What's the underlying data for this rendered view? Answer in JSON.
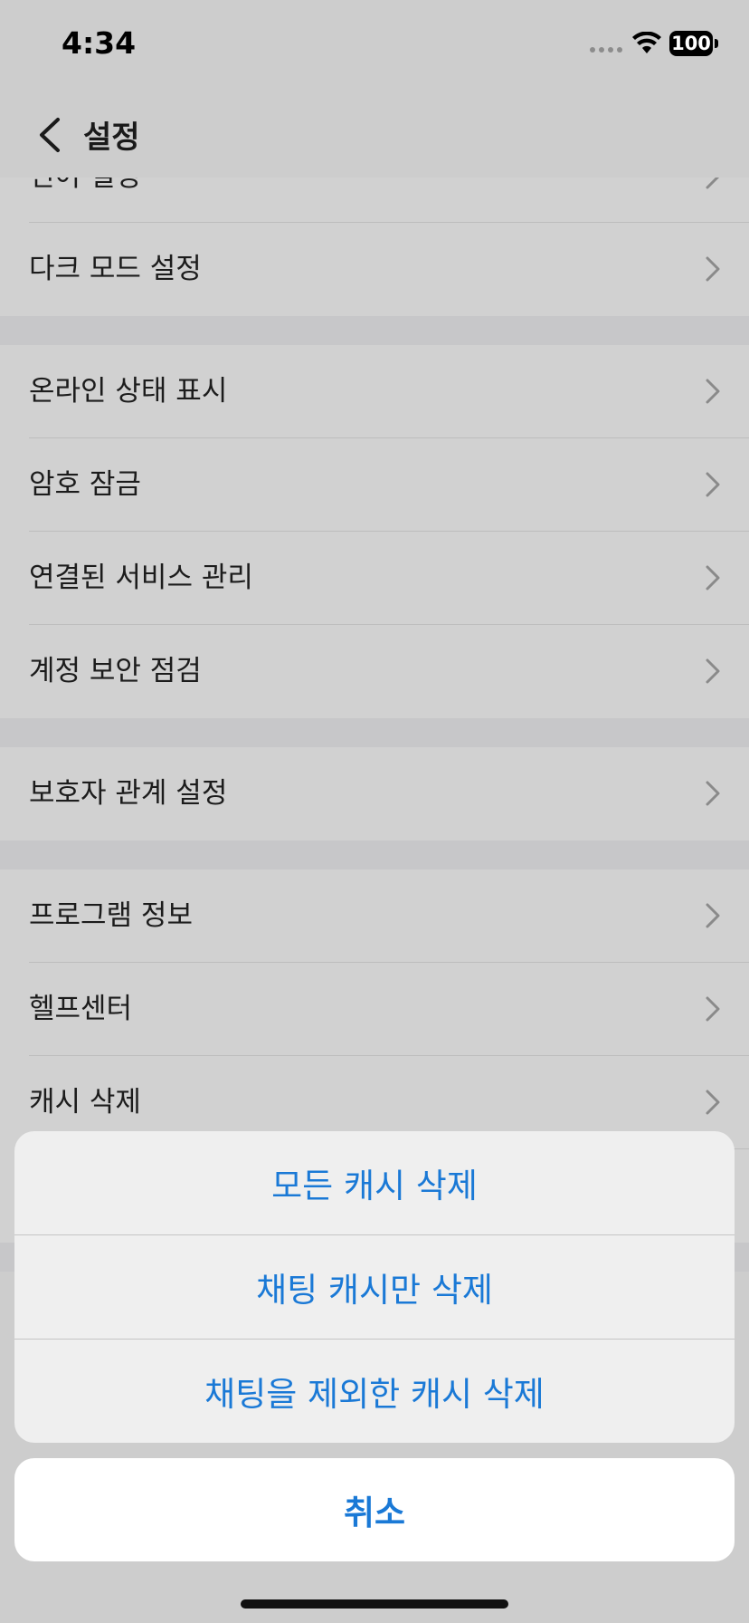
{
  "status": {
    "time": "4:34",
    "battery": "100"
  },
  "nav": {
    "title": "설정"
  },
  "settings": {
    "partial_label": "언어 설정",
    "group1": [
      "다크 모드 설정"
    ],
    "group2": [
      "온라인 상태 표시",
      "암호 잠금",
      "연결된 서비스 관리",
      "계정 보안 점검"
    ],
    "group3": [
      "보호자 관계 설정"
    ],
    "group4": [
      "프로그램 정보",
      "헬프센터",
      "캐시 삭제"
    ]
  },
  "action_sheet": {
    "actions": [
      "모든 캐시 삭제",
      "채팅 캐시만 삭제",
      "채팅을 제외한 캐시 삭제"
    ],
    "cancel": "취소"
  },
  "colors": {
    "accent": "#1a79d6",
    "backdrop": "#cdcdcd"
  }
}
